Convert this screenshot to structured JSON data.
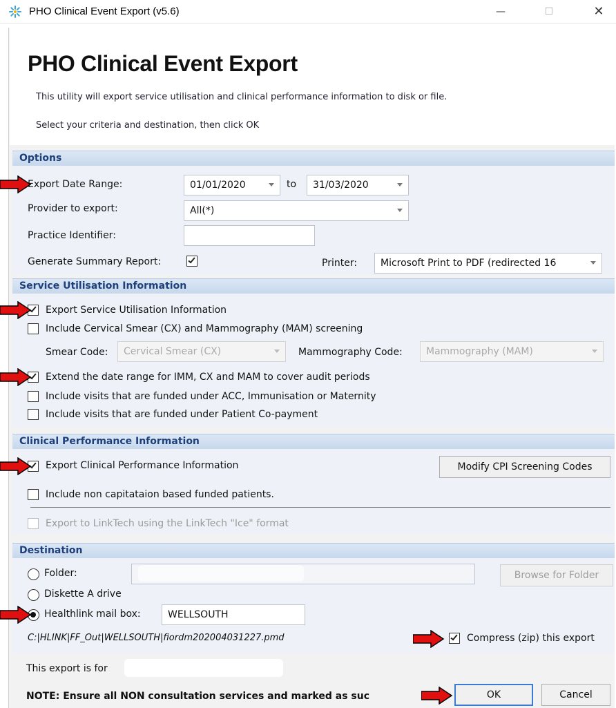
{
  "window": {
    "title": "PHO Clinical Event Export (v5.6)",
    "minimize_label": "—",
    "maximize_label": "☐",
    "close_label": "✕"
  },
  "header": {
    "title": "PHO Clinical Event Export",
    "line1": "This utility will export service utilisation and clinical performance information to disk or file.",
    "line2": "Select your criteria and destination, then click OK"
  },
  "options": {
    "heading": "Options",
    "date_range_label": "Export Date Range:",
    "date_from": "01/01/2020",
    "to_label": "to",
    "date_to": "31/03/2020",
    "provider_label": "Provider to export:",
    "provider_value": "All(*)",
    "practice_label": "Practice Identifier:",
    "practice_value": "",
    "summary_label": "Generate Summary Report:",
    "summary_checked": true,
    "printer_label": "Printer:",
    "printer_value": "Microsoft Print to PDF (redirected 16"
  },
  "service": {
    "heading": "Service Utilisation Information",
    "export_label": "Export Service Utilisation Information",
    "export_checked": true,
    "cervical_label": "Include Cervical Smear (CX) and Mammography (MAM) screening",
    "cervical_checked": false,
    "smear_code_label": "Smear Code:",
    "smear_code_value": "Cervical Smear (CX)",
    "mammo_code_label": "Mammography Code:",
    "mammo_code_value": "Mammography (MAM)",
    "extend_label": "Extend the date range for IMM, CX and MAM to cover audit periods",
    "extend_checked": true,
    "acc_label": "Include visits that are funded under ACC, Immunisation or Maternity",
    "acc_checked": false,
    "copay_label": "Include visits that are funded under Patient Co-payment",
    "copay_checked": false
  },
  "clinical": {
    "heading": "Clinical Performance Information",
    "export_label": "Export Clinical Performance Information",
    "export_checked": true,
    "modify_button": "Modify CPI Screening Codes",
    "noncap_label": "Include non capitataion based funded patients.",
    "noncap_checked": false,
    "linktech_label": "Export to LinkTech using the LinkTech \"Ice\" format",
    "linktech_checked": false
  },
  "destination": {
    "heading": "Destination",
    "folder_label": "Folder:",
    "folder_value": "",
    "browse_button": "Browse for Folder",
    "diskette_label": "Diskette A drive",
    "healthlink_label": "Healthlink mail box:",
    "healthlink_value": "WELLSOUTH",
    "selected": "healthlink",
    "path": "C:|HLINK|FF_Out|WELLSOUTH|fiordm202004031227.pmd",
    "compress_label": "Compress (zip) this export",
    "compress_checked": true
  },
  "footer": {
    "export_for": "This export is for",
    "note": "NOTE: Ensure all NON consultation services and marked as suc",
    "ok_button": "OK",
    "cancel_button": "Cancel"
  },
  "colors": {
    "section_heading": "#1d3f7a",
    "arrow_fill": "#e01010",
    "default_button_border": "#3b7ad4"
  },
  "icons": {
    "app": "gear-sparkle-icon",
    "annotation": "red-arrow-icon"
  }
}
